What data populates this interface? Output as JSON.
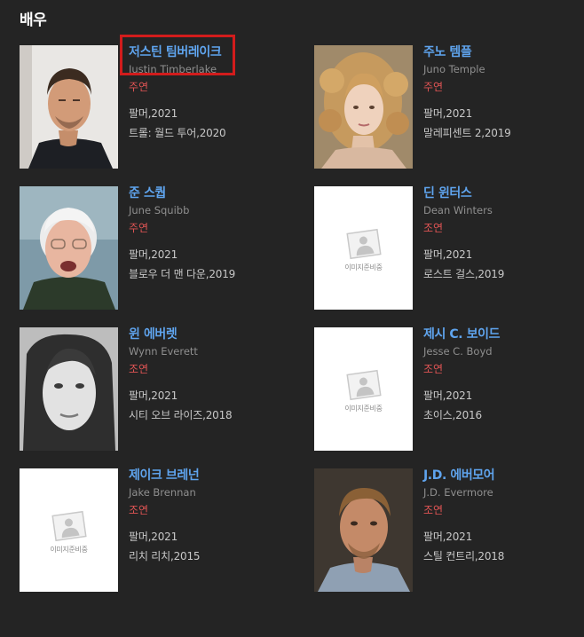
{
  "section": {
    "title": "배우"
  },
  "placeholder_text": "이미지준비중",
  "colors": {
    "background": "#242424",
    "name": "#5fa4ee",
    "role": "#e05454",
    "highlight": "#d21c1c"
  },
  "actors": [
    {
      "name_ko": "저스틴 팀버레이크",
      "name_en": "Justin Timberlake",
      "role": "주연",
      "works": [
        "팔머,2021",
        "트롤: 월드 투어,2020"
      ],
      "photo": "portrait-man-short-hair",
      "selected": true
    },
    {
      "name_ko": "주노 템플",
      "name_en": "Juno Temple",
      "role": "주연",
      "works": [
        "팔머,2021",
        "말레피센트 2,2019"
      ],
      "photo": "portrait-woman-curly-hair",
      "selected": false
    },
    {
      "name_ko": "준 스퀍",
      "name_en": "June Squibb",
      "role": "주연",
      "works": [
        "팔머,2021",
        "블로우 더 맨 다운,2019"
      ],
      "photo": "portrait-elderly-woman",
      "selected": false
    },
    {
      "name_ko": "딘 윈터스",
      "name_en": "Dean Winters",
      "role": "조연",
      "works": [
        "팔머,2021",
        "로스트 걸스,2019"
      ],
      "photo": "placeholder",
      "selected": false
    },
    {
      "name_ko": "윈 에버렛",
      "name_en": "Wynn Everett",
      "role": "조연",
      "works": [
        "팔머,2021",
        "시티 오브 라이즈,2018"
      ],
      "photo": "portrait-woman-bw",
      "selected": false
    },
    {
      "name_ko": "제시 C. 보이드",
      "name_en": "Jesse C. Boyd",
      "role": "조연",
      "works": [
        "팔머,2021",
        "초이스,2016"
      ],
      "photo": "placeholder",
      "selected": false
    },
    {
      "name_ko": "제이크 브레넌",
      "name_en": "Jake Brennan",
      "role": "조연",
      "works": [
        "팔머,2021",
        "리치 리치,2015"
      ],
      "photo": "placeholder",
      "selected": false
    },
    {
      "name_ko": "J.D. 에버모어",
      "name_en": "J.D. Evermore",
      "role": "조연",
      "works": [
        "팔머,2021",
        "스틸 컨트리,2018"
      ],
      "photo": "portrait-man-beard",
      "selected": false
    }
  ]
}
